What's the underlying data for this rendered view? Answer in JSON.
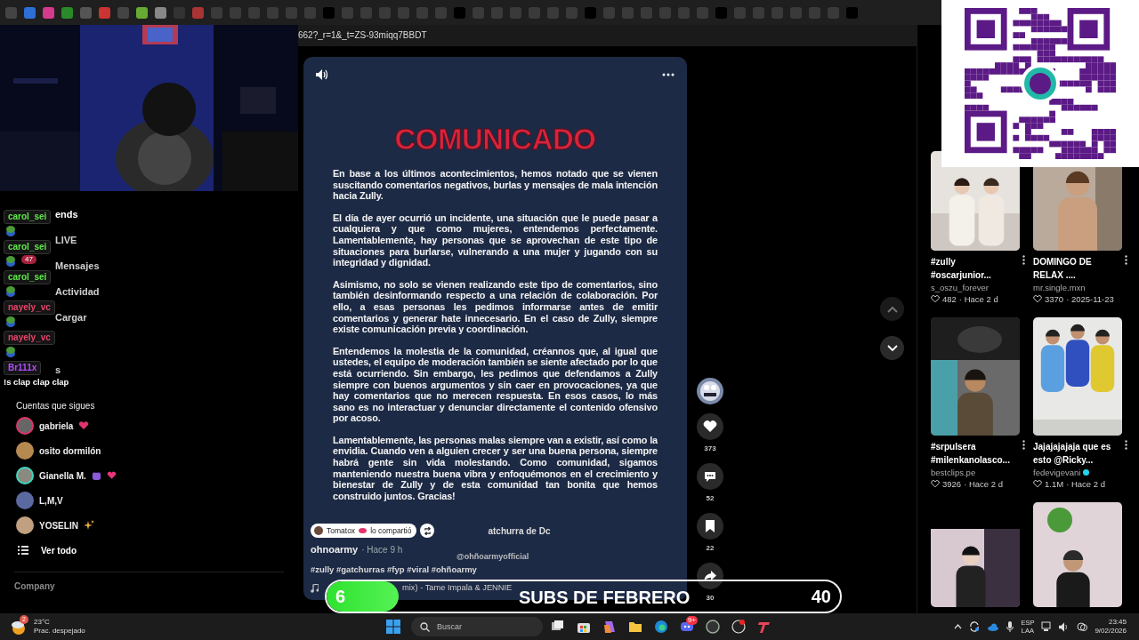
{
  "browser": {
    "address": "662?_r=1&_t=ZS-93miqq7BBDT"
  },
  "sidebar": {
    "items": [
      {
        "label": "ends",
        "kind": "friends"
      },
      {
        "label": "LIVE",
        "kind": "live"
      },
      {
        "label": "Mensajes",
        "kind": "messages",
        "badge": "47"
      },
      {
        "label": "Actividad",
        "kind": "activity"
      },
      {
        "label": "Cargar",
        "kind": "upload"
      },
      {
        "label": "s",
        "kind": "other"
      }
    ],
    "following_title": "Cuentas que sigues",
    "following": [
      {
        "name": "gabriela",
        "color": "#e0356a"
      },
      {
        "name": "osito dormilón"
      },
      {
        "name": "Gianella M.",
        "color": "#3fd9c0"
      },
      {
        "name": "L,M,V"
      },
      {
        "name": "YOSELIN"
      }
    ],
    "see_all": "Ver todo",
    "footer": "Company"
  },
  "chat": {
    "messages": [
      {
        "user": "carol_sei",
        "color": "#5ee84a"
      },
      {
        "user": "carol_sei",
        "color": "#5ee84a"
      },
      {
        "user": "carol_sei",
        "color": "#5ee84a"
      },
      {
        "user": "nayely_vc",
        "color": "#e8446a"
      },
      {
        "user": "nayely_vc",
        "color": "#e8446a"
      },
      {
        "user": "Br111x",
        "color": "#b04cff"
      }
    ],
    "last_text": "!s clap clap clap"
  },
  "post": {
    "heading": "COMUNICADO",
    "paragraphs": [
      "En base a los últimos acontecimientos, hemos notado que se vienen suscitando comentarios negativos, burlas y mensajes de mala intención hacia Zully.",
      "El día de ayer ocurrió un incidente, una situación que le puede pasar a cualquiera y que como mujeres, entendemos perfectamente. Lamentablemente, hay personas que se aprovechan de este tipo de situaciones para burlarse, vulnerando a una mujer y jugando con su integridad y dignidad.",
      "Asimismo, no solo se vienen realizando este tipo de comentarios, sino también desinformando respecto a una relación de colaboración. Por ello, a esas personas les pedimos informarse antes de emitir comentarios y generar hate innecesario. En el caso de Zully, siempre existe comunicación previa y coordinación.",
      "Entendemos la molestia de la comunidad, créannos que, al igual que ustedes, el equipo de moderación también se siente afectado por lo que está ocurriendo. Sin embargo, les pedimos que defendamos a Zully siempre con buenos argumentos y sin caer en provocaciones, ya que hay comentarios que no merecen respuesta. En esos casos, lo más sano es no interactuar y denunciar directamente el contenido ofensivo por acoso.",
      "Lamentablemente, las personas malas siempre van a existir, así como la envidia. Cuando ven a alguien crecer y ser una buena persona, siempre habrá gente sin vida molestando. Como comunidad, sigamos manteniendo nuestra buena vibra y enfoquémonos en el crecimiento y bienestar de Zully y de esta comunidad tan bonita que hemos construido juntos. Gracias!"
    ],
    "shared_by": "Tomatox",
    "shared_label": "lo compartió",
    "caption_fragment": "atchurra de Dc",
    "author": "ohnoarmy",
    "time": "· Hace 9 h",
    "handle": "@ohñoarmyofficial",
    "hashtags": "#zully #gatchurras #fyp #viral #ohñoarmy",
    "music": "mix) - Tame Impala & JENNIE"
  },
  "actions": [
    {
      "kind": "like",
      "count": "373"
    },
    {
      "kind": "comment",
      "count": "52"
    },
    {
      "kind": "save",
      "count": "22"
    },
    {
      "kind": "share",
      "count": "30"
    }
  ],
  "feed": [
    {
      "title": "#zully #oscarjunior...",
      "author": "s_oszu_forever",
      "likes": "482",
      "time": "· Hace 2 d"
    },
    {
      "title": "DOMINGO DE RELAX ....",
      "author": "mr.single.mxn",
      "likes": "3370",
      "time": "· 2025-11-23"
    },
    {
      "title": "#srpulsera #milenkanolasco...",
      "author": "bestclips.pe",
      "likes": "3926",
      "time": "· Hace 2 d"
    },
    {
      "title": "Jajajajajaja que es esto @Ricky...",
      "author": "fedevigevani",
      "verified": true,
      "likes": "1.1M",
      "time": "· Hace 2 d"
    }
  ],
  "subs_goal": {
    "current": "6",
    "label": "SUBS DE FEBRERO",
    "target": "40",
    "level": 0.14
  },
  "taskbar": {
    "temperature": "23°C",
    "condition": "Prac. despejado",
    "weather_badge": "2",
    "search_placeholder": "Buscar",
    "discord_badge": "9+",
    "language": "ESP",
    "layout": "LAA",
    "time": "23:45",
    "date": "9/02/2026"
  }
}
